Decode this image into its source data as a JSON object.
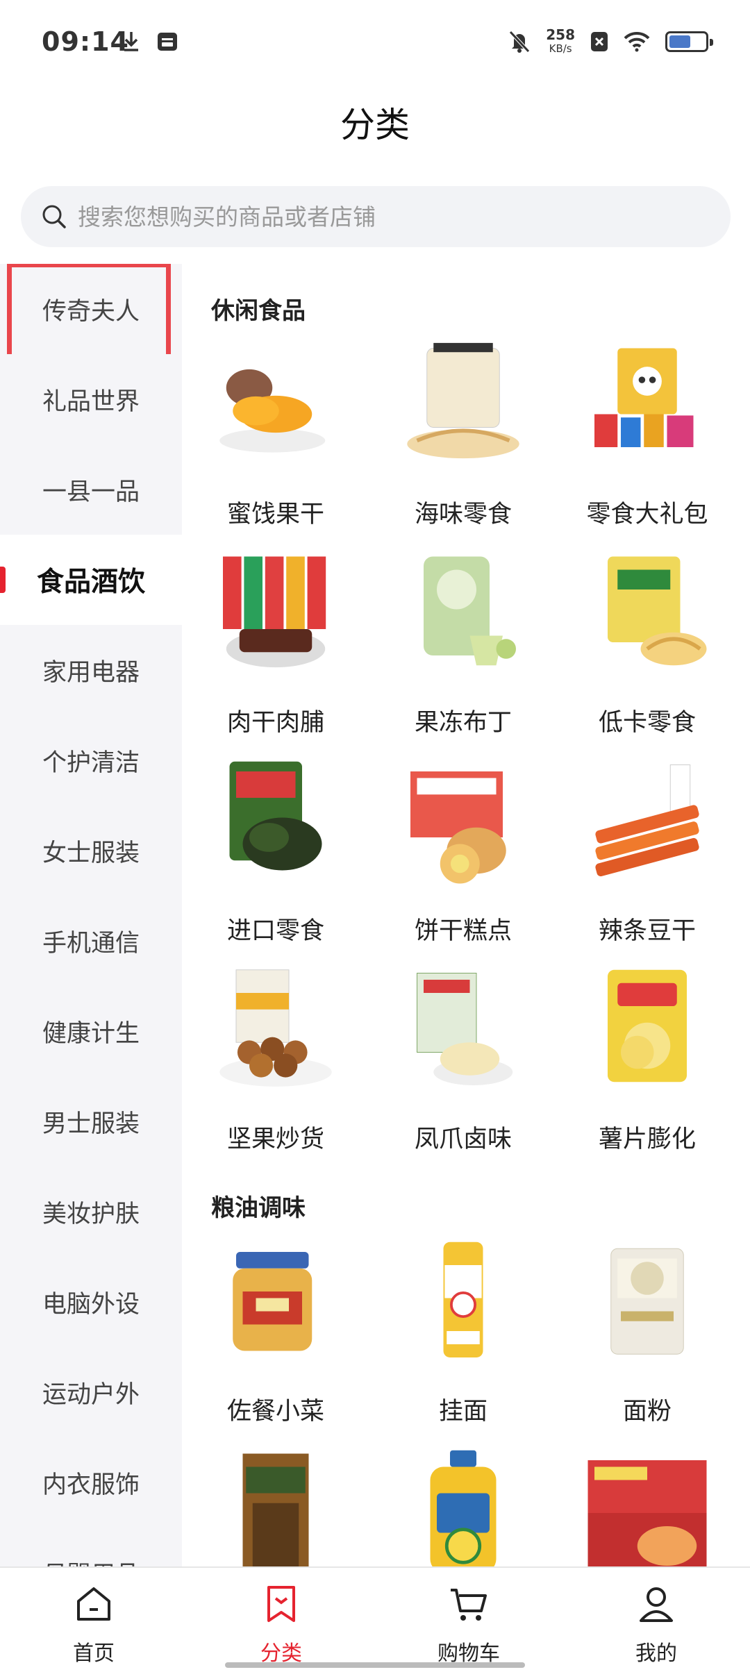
{
  "status_bar": {
    "time": "09:14",
    "net_speed_value": "258",
    "net_speed_unit": "KB/s",
    "battery_level": 0.6,
    "icons": [
      "download-icon",
      "notification-icon",
      "mute-bell-icon",
      "close-box-icon",
      "wifi-icon",
      "battery-icon"
    ]
  },
  "header": {
    "title": "分类"
  },
  "search": {
    "placeholder": "搜索您想购买的商品或者店铺"
  },
  "sidebar": {
    "items": [
      {
        "label": "传奇夫人"
      },
      {
        "label": "礼品世界"
      },
      {
        "label": "一县一品"
      },
      {
        "label": "食品酒饮"
      },
      {
        "label": "家用电器"
      },
      {
        "label": "个护清洁"
      },
      {
        "label": "女士服装"
      },
      {
        "label": "手机通信"
      },
      {
        "label": "健康计生"
      },
      {
        "label": "男士服装"
      },
      {
        "label": "美妆护肤"
      },
      {
        "label": "电脑外设"
      },
      {
        "label": "运动户外"
      },
      {
        "label": "内衣服饰"
      },
      {
        "label": "母婴用品"
      }
    ],
    "active_index": 3,
    "highlighted_index": 0
  },
  "sections": [
    {
      "title": "休闲食品",
      "items": [
        {
          "label": "蜜饯果干",
          "icon": "dried-mango-image"
        },
        {
          "label": "海味零食",
          "icon": "seafood-snack-image"
        },
        {
          "label": "零食大礼包",
          "icon": "snack-gift-pack-image"
        },
        {
          "label": "肉干肉脯",
          "icon": "beef-jerky-image"
        },
        {
          "label": "果冻布丁",
          "icon": "jelly-pudding-image"
        },
        {
          "label": "低卡零食",
          "icon": "low-cal-snack-image"
        },
        {
          "label": "进口零食",
          "icon": "imported-snack-image"
        },
        {
          "label": "饼干糕点",
          "icon": "biscuit-pastry-image"
        },
        {
          "label": "辣条豆干",
          "icon": "spicy-strip-image"
        },
        {
          "label": "坚果炒货",
          "icon": "nuts-image"
        },
        {
          "label": "凤爪卤味",
          "icon": "chicken-feet-image"
        },
        {
          "label": "薯片膨化",
          "icon": "potato-chips-image"
        }
      ]
    },
    {
      "title": "粮油调味",
      "items": [
        {
          "label": "佐餐小菜",
          "icon": "pickled-vegetables-image"
        },
        {
          "label": "挂面",
          "icon": "noodles-image"
        },
        {
          "label": "面粉",
          "icon": "flour-image"
        },
        {
          "label": "",
          "icon": "star-anise-image"
        },
        {
          "label": "",
          "icon": "cooking-oil-image"
        },
        {
          "label": "",
          "icon": "instant-food-box-image"
        }
      ]
    }
  ],
  "bottom_nav": {
    "items": [
      {
        "label": "首页",
        "icon": "home-icon"
      },
      {
        "label": "分类",
        "icon": "category-icon"
      },
      {
        "label": "购物车",
        "icon": "cart-icon"
      },
      {
        "label": "我的",
        "icon": "profile-icon"
      }
    ],
    "active_index": 1
  },
  "colors": {
    "accent": "#e5232f",
    "highlight_box": "#e9464c",
    "sidebar_bg": "#f5f5f8",
    "search_bg": "#f2f3f6"
  }
}
